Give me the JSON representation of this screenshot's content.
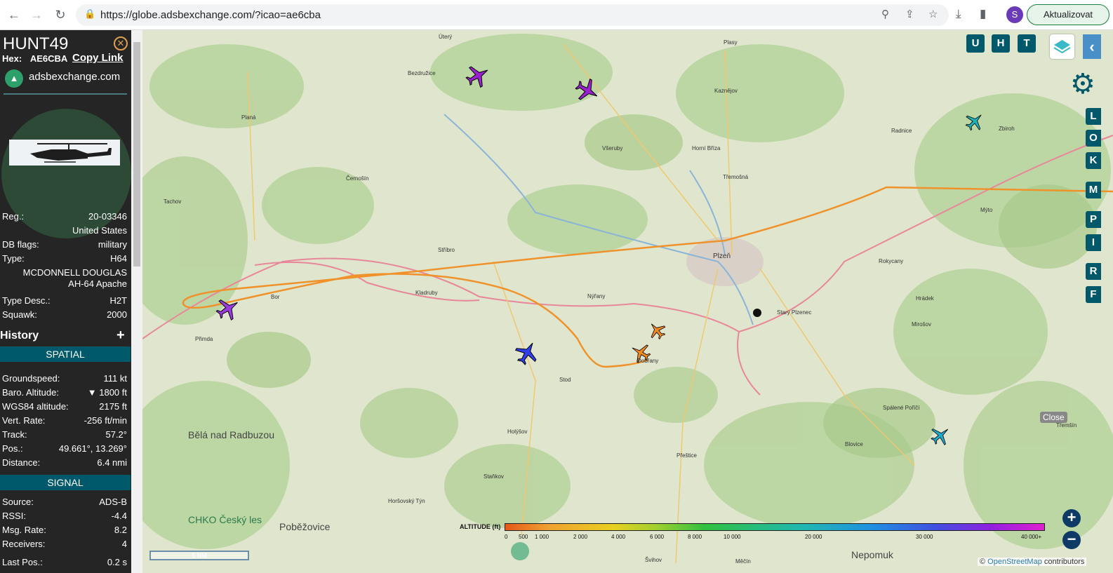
{
  "browser": {
    "url": "https://globe.adsbexchange.com/?icao=ae6cba",
    "profile_initial": "S",
    "update_label": "Aktualizovat"
  },
  "aircraft": {
    "callsign": "HUNT49",
    "hex_label": "Hex:",
    "hex": "AE6CBA",
    "copy_link": "Copy Link",
    "site": "adsbexchange.com",
    "details": [
      {
        "label": "Reg.:",
        "value": "20-03346"
      },
      {
        "label": "",
        "value": "United States"
      },
      {
        "label": "DB flags:",
        "value": "military"
      },
      {
        "label": "Type:",
        "value": "H64"
      },
      {
        "label": "",
        "value": "MCDONNELL DOUGLAS"
      },
      {
        "label": "",
        "value": "AH-64 Apache"
      },
      {
        "label": "Type Desc.:",
        "value": "H2T"
      },
      {
        "label": "Squawk:",
        "value": "2000"
      }
    ]
  },
  "history": {
    "title": "History",
    "spatial_title": "SPATIAL",
    "spatial": [
      {
        "label": "Groundspeed:",
        "value": "111 kt"
      },
      {
        "label": "Baro. Altitude:",
        "value": "▼ 1800 ft"
      },
      {
        "label": "WGS84 altitude:",
        "value": "2175 ft"
      },
      {
        "label": "Vert. Rate:",
        "value": "-256 ft/min"
      },
      {
        "label": "Track:",
        "value": "57.2°"
      },
      {
        "label": "Pos.:",
        "value": "49.661°, 13.269°"
      },
      {
        "label": "Distance:",
        "value": "6.4 nmi"
      }
    ],
    "signal_title": "SIGNAL",
    "signal": [
      {
        "label": "Source:",
        "value": "ADS-B"
      },
      {
        "label": "RSSI:",
        "value": "-4.4"
      },
      {
        "label": "Msg. Rate:",
        "value": "8.2"
      },
      {
        "label": "Receivers:",
        "value": "4"
      },
      {
        "label": "Last Pos.:",
        "value": "0.2 s"
      }
    ]
  },
  "map": {
    "top_buttons": [
      "U",
      "H",
      "T"
    ],
    "side_buttons": [
      "L",
      "O",
      "K",
      "M",
      "P",
      "I",
      "R",
      "F"
    ],
    "close_label": "Close",
    "scale": "5 NM",
    "attribution_prefix": "©",
    "attribution_link": "OpenStreetMap",
    "attribution_suffix": "contributors",
    "altitude_title": "ALTITUDE (ft)",
    "altitude_ticks": [
      "0",
      "500",
      "1 000",
      "2 000",
      "4 000",
      "6 000",
      "8 000",
      "10 000",
      "20 000",
      "30 000",
      "40 000+"
    ],
    "places_small": [
      "Úterý",
      "Bezdružice",
      "Plasy",
      "Kaznějov",
      "Všeruby",
      "Horní Bříza",
      "Třemošná",
      "Černošín",
      "Planá",
      "Tachov",
      "Stříbro",
      "Kladruby",
      "Bor",
      "Přimda",
      "Nýřany",
      "Plzeň",
      "Rokycany",
      "Radnice",
      "Zbiroh",
      "Mýto",
      "Hrádek",
      "Mirošov",
      "Starý Plzenec",
      "Dobřany",
      "Stod",
      "Holýšov",
      "Přeštice",
      "Spálené Poříčí",
      "Blovice",
      "Staňkov",
      "Horšovský Týn",
      "Švihov",
      "Měčín",
      "Třemšín"
    ],
    "places_big": [
      "Bělá nad Radbuzou",
      "CHKO Český les",
      "Poběžovice",
      "Nepomuk"
    ]
  },
  "colors": {
    "sidebar_bg": "#252525",
    "section_bar": "#00596b",
    "track": "#f0922b",
    "accent": "#00596b"
  }
}
